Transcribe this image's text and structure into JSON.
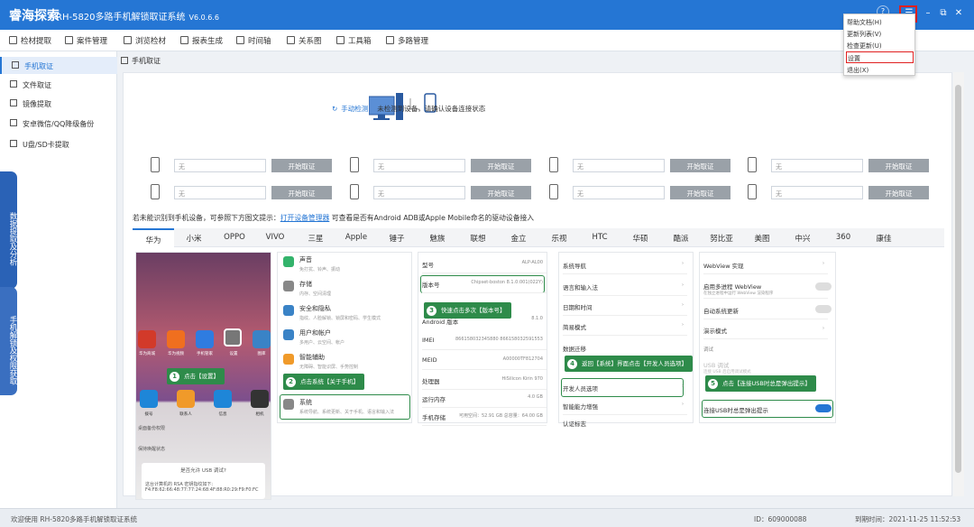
{
  "titlebar": {
    "brand": "睿海探索",
    "title": "RH-5820多路手机解锁取证系统",
    "version": "V6.0.6.6",
    "controls": {
      "help": "?",
      "menu": "☰",
      "minimize": "–",
      "restore": "⧉",
      "close": "✕"
    }
  },
  "toolbar": {
    "items": [
      {
        "label": "检材提取",
        "icon": "extract-icon"
      },
      {
        "label": "案件管理",
        "icon": "case-icon"
      },
      {
        "label": "浏览检材",
        "icon": "browse-icon"
      },
      {
        "label": "报表生成",
        "icon": "report-icon"
      },
      {
        "label": "时间轴",
        "icon": "timeline-icon"
      },
      {
        "label": "关系图",
        "icon": "graph-icon"
      },
      {
        "label": "工具箱",
        "icon": "toolbox-icon"
      },
      {
        "label": "多路管理",
        "icon": "multi-icon"
      }
    ]
  },
  "sidebar": {
    "items": [
      {
        "label": "手机取证",
        "active": true
      },
      {
        "label": "文件取证"
      },
      {
        "label": "镜像提取"
      },
      {
        "label": "安卓微信/QQ降级备份"
      },
      {
        "label": "U盘/SD卡提取"
      }
    ],
    "vtabs": [
      "数据提取及分析",
      "手机解锁及权限获取"
    ]
  },
  "breadcrumb": "手机取证",
  "detect": {
    "link": "手动检测",
    "message": "未检测到设备，请确认设备连接状态"
  },
  "devices": {
    "placeholder": "无",
    "button": "开始取证",
    "count": 8
  },
  "hint": {
    "prefix": "若未能识别到手机设备，可参照下方图文提示：",
    "link": "打开设备管理器",
    "suffix": "可查看是否有Android ADB或Apple Mobile命名的驱动设备接入"
  },
  "brands": [
    "华为",
    "小米",
    "OPPO",
    "VIVO",
    "三星",
    "Apple",
    "锤子",
    "魅族",
    "联想",
    "金立",
    "乐视",
    "HTC",
    "华硕",
    "酷派",
    "努比亚",
    "美图",
    "中兴",
    "360",
    "康佳"
  ],
  "guide": {
    "home_apps": [
      "华为商城",
      "华为视频",
      "手机管家",
      "设置",
      "图库"
    ],
    "dock_apps": [
      "拨号",
      "联系人",
      "信息",
      "相机"
    ],
    "settings_list": [
      {
        "title": "声音",
        "sub": "免打扰、铃声、振动"
      },
      {
        "title": "存储",
        "sub": "内存、空间清理"
      },
      {
        "title": "安全和隐私",
        "sub": "指纹、人脸解锁、锁屏和密码、学生模式"
      },
      {
        "title": "用户和帐户",
        "sub": "多用户、云空间、帐户"
      },
      {
        "title": "智能辅助",
        "sub": "无障碍、智能识屏、手势控制"
      },
      {
        "title": "系统",
        "sub": "系统导航、系统更新、关于手机、语言和输入法"
      }
    ],
    "about_rows": [
      {
        "k": "型号",
        "v": "ALP-AL00"
      },
      {
        "k": "版本号",
        "v": "Chipset-boston 8.1.0.001(022Y)"
      },
      {
        "k": "EMUI 版本",
        "v": "8.0.0"
      },
      {
        "k": "Android 版本",
        "v": "8.1.0"
      },
      {
        "k": "IMEI",
        "v": "866158032345880 866158032591553"
      },
      {
        "k": "MEID",
        "v": "A00000TF812704"
      },
      {
        "k": "处理器",
        "v": "HiSilicon Kirin 970"
      },
      {
        "k": "运行内存",
        "v": "4.0 GB"
      },
      {
        "k": "手机存储",
        "v": "可用空间：52.91 GB 总容量：64.00 GB"
      }
    ],
    "system_rows": [
      "系统导航",
      "语言和输入法",
      "日期和时间",
      "简易模式",
      "数据迁移",
      "开发人员选项",
      "智能能力增强",
      "认证标志"
    ],
    "dev_rows": [
      "WebView 实现",
      "启用多进程 WebView",
      "在独立进程中运行 WebView 渲染程序",
      "自动系统更新",
      "演示模式",
      "调试",
      "USB 调试",
      "连接 USB 后启用调试模式",
      "连接USB时总是弹出提示"
    ],
    "lock_rows": [
      "桌面备份权限",
      "保持唤醒状态",
      "是否允许 USB 调试?",
      "这台计算机的 RSA 密钥指纹如下:",
      "F4:F8:62:66:48:77:77:24:68:4F:88:R0:29:F9:F0:FC"
    ],
    "callouts": [
      "点击【设置】",
      "点击系统【关于手机】",
      "快速点击多次【版本号】",
      "返回【系统】界面点击【开发人员选项】",
      "点击【连接USB时总是弹出提示】"
    ]
  },
  "dropdown": {
    "items": [
      "帮助文档(H)",
      "更新列表(V)",
      "检查更新(U)",
      "设置",
      "退出(X)"
    ]
  },
  "statusbar": {
    "welcome": "欢迎使用 RH-5820多路手机解锁取证系统",
    "id": "ID：609000088",
    "expiry": "到期时间：2021-11-25 11:52:53"
  },
  "colors": {
    "primary": "#2576d4",
    "guide_green": "#2e8b4a",
    "annotation_red": "#e02020"
  }
}
